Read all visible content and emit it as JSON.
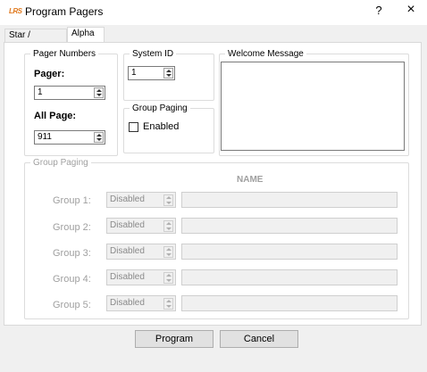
{
  "window": {
    "logo_text": "LRS",
    "title": "Program Pagers",
    "help_label": "?",
    "close_label": "×"
  },
  "tabs": [
    {
      "label": "Star / Coaster",
      "selected": false
    },
    {
      "label": "Alpha",
      "selected": true
    }
  ],
  "pager_numbers": {
    "legend": "Pager Numbers",
    "pager_label": "Pager:",
    "pager_value": "1",
    "all_page_label": "All Page:",
    "all_page_value": "911"
  },
  "system_id": {
    "legend": "System ID",
    "value": "1"
  },
  "group_paging_top": {
    "legend": "Group Paging",
    "enabled_label": "Enabled",
    "enabled_checked": false
  },
  "welcome_message": {
    "legend": "Welcome Message",
    "value": ""
  },
  "group_paging": {
    "legend": "Group Paging",
    "name_header": "NAME",
    "groups": [
      {
        "label": "Group 1:",
        "mode": "Disabled",
        "name": ""
      },
      {
        "label": "Group 2:",
        "mode": "Disabled",
        "name": ""
      },
      {
        "label": "Group 3:",
        "mode": "Disabled",
        "name": ""
      },
      {
        "label": "Group 4:",
        "mode": "Disabled",
        "name": ""
      },
      {
        "label": "Group 5:",
        "mode": "Disabled",
        "name": ""
      }
    ]
  },
  "buttons": {
    "program_label": "Program",
    "cancel_label": "Cancel"
  }
}
